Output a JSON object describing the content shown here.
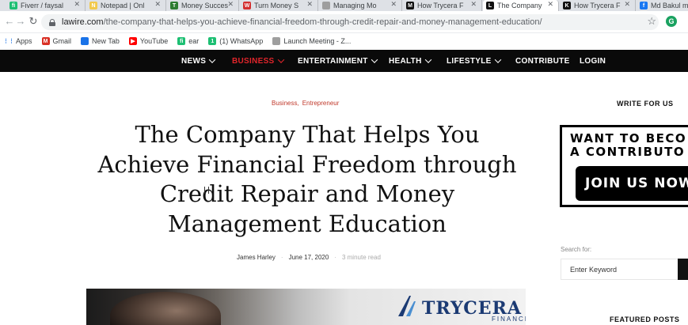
{
  "browser": {
    "tabs": [
      {
        "label": "Fiverr / faysal",
        "icon": "fiverr-icon",
        "color": "#1dbf73",
        "letter": "fi"
      },
      {
        "label": "Notepad | Onl",
        "icon": "notepad-icon",
        "color": "#f2c94c",
        "letter": "N"
      },
      {
        "label": "Money Succes",
        "icon": "money-success-icon",
        "color": "#2e7d32",
        "letter": "T"
      },
      {
        "label": "Turn Money S",
        "icon": "turn-money-icon",
        "color": "#d32f2f",
        "letter": "W"
      },
      {
        "label": "Managing Mo",
        "icon": "document-icon",
        "color": "#9e9e9e",
        "letter": ""
      },
      {
        "label": "How Trycera F",
        "icon": "m-icon",
        "color": "#111111",
        "letter": "M"
      },
      {
        "label": "The Company",
        "icon": "lawire-icon",
        "color": "#111111",
        "letter": "L",
        "active": true
      },
      {
        "label": "How Trycera F",
        "icon": "k-icon",
        "color": "#111111",
        "letter": "K"
      },
      {
        "label": "Md Bakul m",
        "icon": "facebook-icon",
        "color": "#1877f2",
        "letter": "f"
      }
    ],
    "url_host": "lawire.com",
    "url_path": "/the-company-that-helps-you-achieve-financial-freedom-through-credit-repair-and-money-management-education/",
    "extension_letter": "G",
    "bookmarks": [
      {
        "label": "Apps",
        "icon": "apps-grid-icon",
        "color": "#5f6368",
        "letter": ""
      },
      {
        "label": "Gmail",
        "icon": "gmail-icon",
        "color": "#d93025",
        "letter": "M"
      },
      {
        "label": "New Tab",
        "icon": "new-tab-icon",
        "color": "#1a73e8",
        "letter": ""
      },
      {
        "label": "YouTube",
        "icon": "youtube-icon",
        "color": "#ff0000",
        "letter": "▶"
      },
      {
        "label": "ear",
        "icon": "ear-icon",
        "color": "#1dbf73",
        "letter": "fi"
      },
      {
        "label": "(1) WhatsApp",
        "icon": "whatsapp-icon",
        "color": "#1dbf73",
        "letter": "1"
      },
      {
        "label": "Launch Meeting - Z...",
        "icon": "zoom-icon",
        "color": "#9e9e9e",
        "letter": ""
      }
    ]
  },
  "site": {
    "nav": [
      {
        "label": "NEWS",
        "dropdown": true
      },
      {
        "label": "BUSINESS",
        "dropdown": true,
        "active": true
      },
      {
        "label": "ENTERTAINMENT",
        "dropdown": true
      },
      {
        "label": "HEALTH",
        "dropdown": true
      },
      {
        "label": "LIFESTYLE",
        "dropdown": true
      },
      {
        "label": "CONTRIBUTE",
        "dropdown": false
      },
      {
        "label": "LOGIN",
        "dropdown": false
      }
    ],
    "accent_color": "#e2252b"
  },
  "article": {
    "categories": [
      "Business,",
      "Entrepreneur"
    ],
    "title_lines": [
      "The Company That Helps You",
      "Achieve Financial Freedom through",
      "Credit Repair and Money",
      "Management Education"
    ],
    "author": "James Harley",
    "date": "June 17, 2020",
    "read_time": "3 minute read",
    "image_logo": "TRYCERA",
    "image_logo_sub": "FINANCIAL"
  },
  "sidebar": {
    "write_heading": "WRITE FOR US",
    "banner_line1": "WANT TO BECO",
    "banner_line2": "A CONTRIBUTO",
    "banner_button": "JOIN US NOW",
    "search_label": "Search for:",
    "search_placeholder": "Enter Keyword",
    "featured_heading": "FEATURED POSTS"
  }
}
